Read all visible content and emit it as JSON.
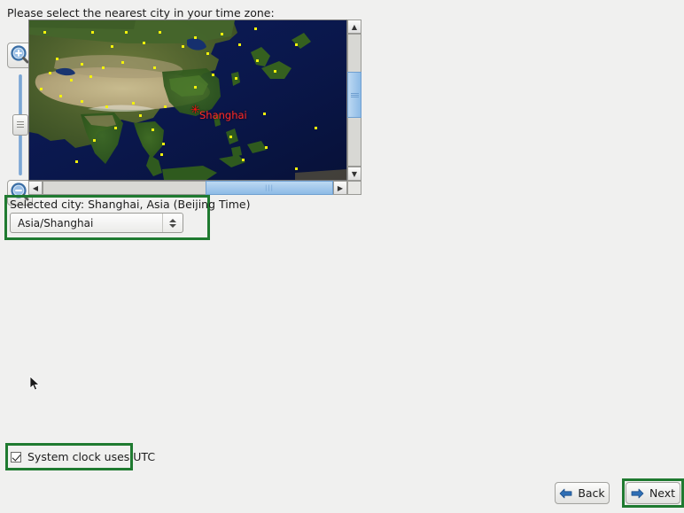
{
  "prompt": "Please select the nearest city in your time zone:",
  "map": {
    "selected_marker_label": "Shanghai",
    "marker_glyph": "✳",
    "zoom_in_icon": "zoom-in-icon",
    "zoom_out_icon": "zoom-out-icon",
    "scroll_up_glyph": "▲",
    "scroll_down_glyph": "▼",
    "scroll_left_glyph": "◀",
    "scroll_right_glyph": "▶",
    "hthumb_glyph": "|||"
  },
  "selection": {
    "label": "Selected city: Shanghai, Asia (Beijing Time)",
    "timezone_value": "Asia/Shanghai",
    "timezone_options": [
      "Asia/Shanghai"
    ]
  },
  "utc": {
    "label": "System clock uses UTC",
    "checked": true
  },
  "nav": {
    "back_label": "Back",
    "next_label": "Next"
  },
  "colors": {
    "highlight_green": "#1f7a30",
    "marker_red": "#ff2a2a",
    "city_dot_yellow": "#f2f20c",
    "scroll_blue": "#8dbbe6",
    "window_bg": "#f0f0ef"
  }
}
